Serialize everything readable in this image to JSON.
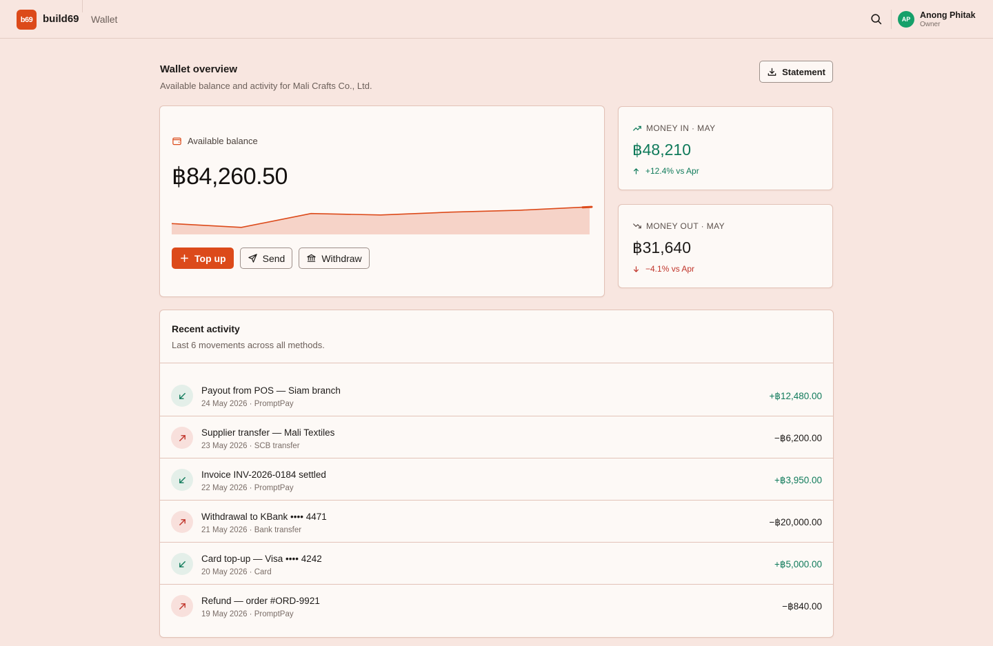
{
  "topbar": {
    "logo_text": "b69",
    "brand": "build69",
    "crumb": "Wallet",
    "user": {
      "initials": "AP",
      "name": "Anong Phitak",
      "role": "Owner"
    }
  },
  "header": {
    "title": "Wallet overview",
    "subtitle": "Available balance and activity for Mali Crafts Co., Ltd.",
    "statement_label": "Statement"
  },
  "balance": {
    "label": "Available balance",
    "amount": "฿84,260.50",
    "trend": [
      0.72,
      0.64,
      0.93,
      0.9,
      0.96,
      1.0,
      1.07
    ],
    "actions": {
      "topup": "Top up",
      "send": "Send",
      "withdraw": "Withdraw"
    }
  },
  "stats": {
    "money_in": {
      "label": "MONEY IN · MAY",
      "value": "฿48,210",
      "delta": "+12.4% vs Apr"
    },
    "money_out": {
      "label": "MONEY OUT · MAY",
      "value": "฿31,640",
      "delta": "−4.1% vs Apr"
    }
  },
  "activity": {
    "title": "Recent activity",
    "subtitle": "Last 6 movements across all methods.",
    "rows": [
      {
        "direction": "in",
        "title": "Payout from POS — Siam branch",
        "meta": "24 May 2026 · PromptPay",
        "amount": "+฿12,480.00"
      },
      {
        "direction": "out",
        "title": "Supplier transfer — Mali Textiles",
        "meta": "23 May 2026 · SCB transfer",
        "amount": "−฿6,200.00"
      },
      {
        "direction": "in",
        "title": "Invoice INV-2026-0184 settled",
        "meta": "22 May 2026 · PromptPay",
        "amount": "+฿3,950.00"
      },
      {
        "direction": "out",
        "title": "Withdrawal to KBank •••• 4471",
        "meta": "21 May 2026 · Bank transfer",
        "amount": "−฿20,000.00"
      },
      {
        "direction": "in",
        "title": "Card top-up — Visa •••• 4242",
        "meta": "20 May 2026 · Card",
        "amount": "+฿5,000.00"
      },
      {
        "direction": "out",
        "title": "Refund — order #ORD-9921",
        "meta": "19 May 2026 · PromptPay",
        "amount": "−฿840.00"
      }
    ]
  },
  "colors": {
    "accent": "#dc4a1a",
    "positive": "#0f7a5a",
    "negative": "#c0342a",
    "background": "#f8e6e0"
  }
}
